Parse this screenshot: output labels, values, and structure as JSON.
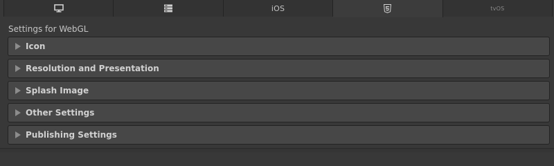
{
  "tabs": [
    {
      "label": "",
      "icon": "desktop-monitor-icon",
      "active": false
    },
    {
      "label": "",
      "icon": "server-rack-icon",
      "active": false
    },
    {
      "label": "iOS",
      "icon": "",
      "active": false
    },
    {
      "label": "",
      "icon": "html5-icon",
      "active": true
    },
    {
      "label": "tvOS",
      "icon": "",
      "active": false
    }
  ],
  "section_title": "Settings for WebGL",
  "foldouts": [
    {
      "label": "Icon",
      "expanded": false
    },
    {
      "label": "Resolution and Presentation",
      "expanded": false
    },
    {
      "label": "Splash Image",
      "expanded": false
    },
    {
      "label": "Other Settings",
      "expanded": false
    },
    {
      "label": "Publishing Settings",
      "expanded": false
    }
  ],
  "colors": {
    "background": "#383838",
    "foldout_bg": "#474747",
    "tab_bg": "#333333",
    "tab_active_bg": "#3c3c3c"
  }
}
